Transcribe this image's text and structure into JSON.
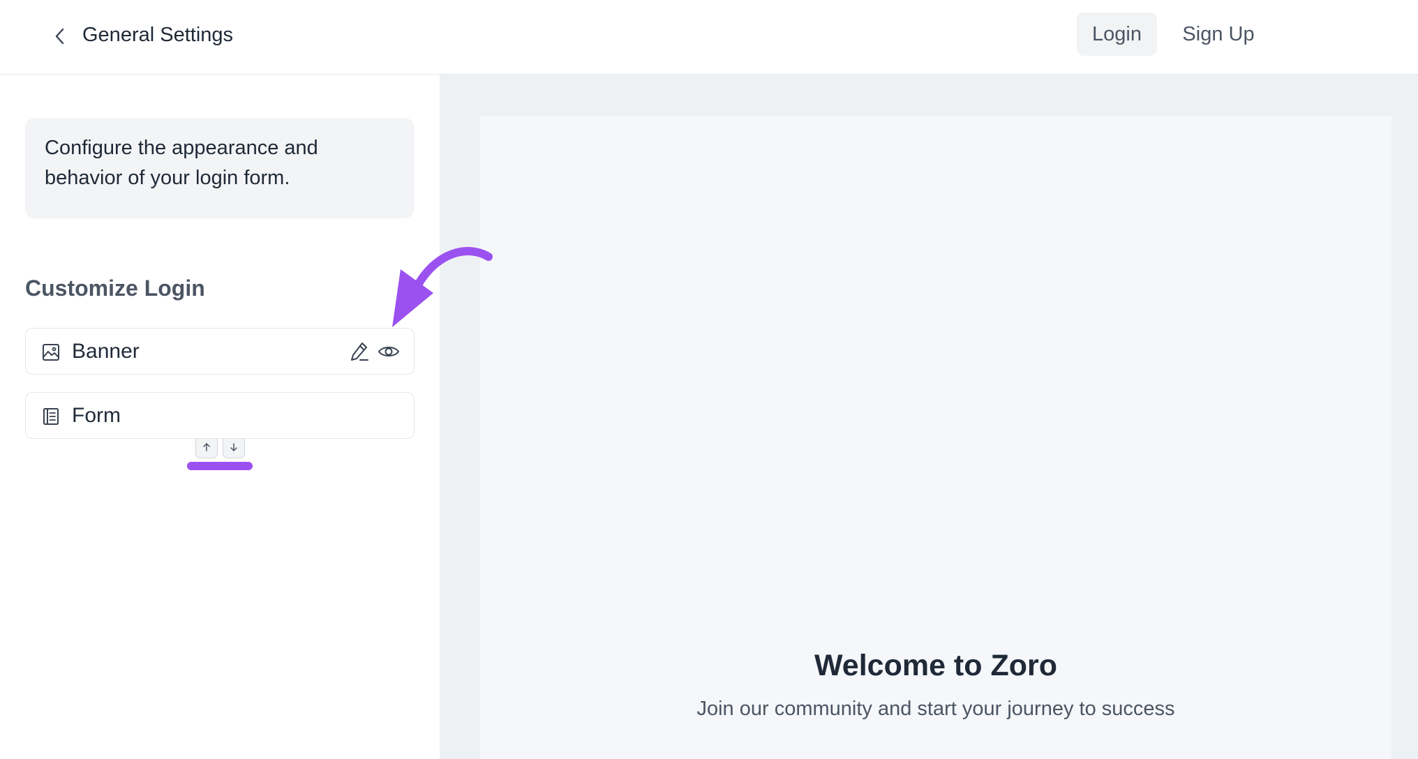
{
  "header": {
    "title": "General Settings",
    "tabs": [
      {
        "label": "Login",
        "active": true
      },
      {
        "label": "Sign Up",
        "active": false
      }
    ]
  },
  "sidebar": {
    "info_text": "Configure the appearance and behavior of your login form.",
    "section_heading": "Customize Login",
    "items": [
      {
        "label": "Banner",
        "icon": "image-icon"
      },
      {
        "label": "Form",
        "icon": "form-icon"
      }
    ],
    "reorder": {
      "up_icon": "arrow-up-icon",
      "down_icon": "arrow-down-icon"
    }
  },
  "preview": {
    "title": "Welcome to Zoro",
    "subtitle": "Join our community and start your journey to success"
  },
  "colors": {
    "accent": "#9b51f0",
    "preview_bg": "#eef1f4",
    "canvas_bg": "#f5f7fa",
    "active_tab_bg": "#f1f3f5"
  }
}
